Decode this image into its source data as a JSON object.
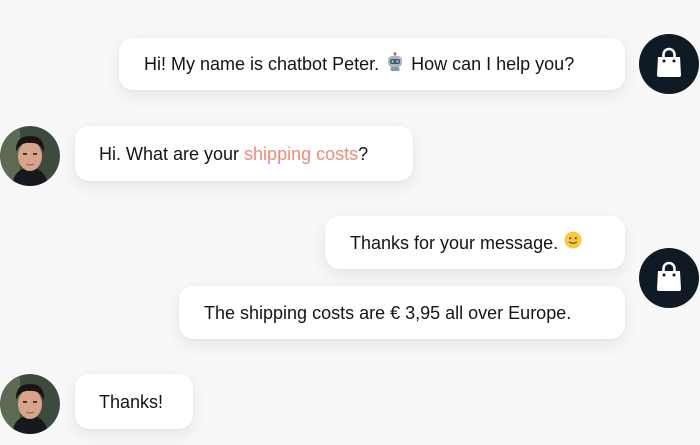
{
  "messages": [
    {
      "sender": "bot",
      "text_before": "Hi! My name is chatbot Peter.",
      "emoji": "robot-emoji",
      "text_after": "How can I help you?"
    },
    {
      "sender": "user",
      "text_before": "Hi. What are your ",
      "link_text": "shipping costs",
      "text_after": "?"
    },
    {
      "sender": "bot",
      "text_before": "Thanks for your message.",
      "emoji": "slightly-smiling-face-emoji"
    },
    {
      "sender": "bot",
      "text": "The shipping costs are € 3,95 all over Europe."
    },
    {
      "sender": "user",
      "text": "Thanks!"
    }
  ],
  "colors": {
    "background": "#f8f8f9",
    "bubble": "#ffffff",
    "text": "#111418",
    "highlight": "#ea8c78",
    "bot_avatar": "#0f1a24"
  }
}
